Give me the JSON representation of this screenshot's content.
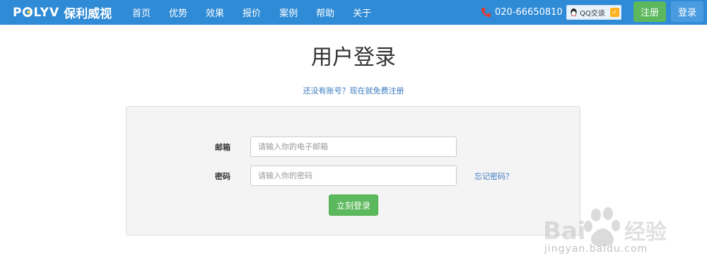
{
  "header": {
    "logo_en": "POLYV",
    "logo_cn": "保利威视",
    "nav": [
      {
        "label": "首页"
      },
      {
        "label": "优势"
      },
      {
        "label": "效果"
      },
      {
        "label": "报价"
      },
      {
        "label": "案例"
      },
      {
        "label": "帮助"
      },
      {
        "label": "关于"
      }
    ],
    "phone": "020-66650810",
    "qq_label": "QQ交谈",
    "register_label": "注册",
    "login_label": "登录"
  },
  "main": {
    "title": "用户登录",
    "register_prompt": "还没有账号？现在就免费注册",
    "email_label": "邮箱",
    "email_placeholder": "请输入你的电子邮箱",
    "email_value": "",
    "password_label": "密码",
    "password_placeholder": "请输入你的密码",
    "password_value": "",
    "forgot_label": "忘记密码？",
    "submit_label": "立刻登录"
  },
  "watermark": {
    "brand": "Bai du 经验",
    "url": "jingyan.baidu.com"
  },
  "colors": {
    "topbar": "#2f8bd6",
    "register_green": "#5cb85c",
    "link_blue": "#3a7bbf",
    "panel_bg": "#f4f4f4"
  }
}
